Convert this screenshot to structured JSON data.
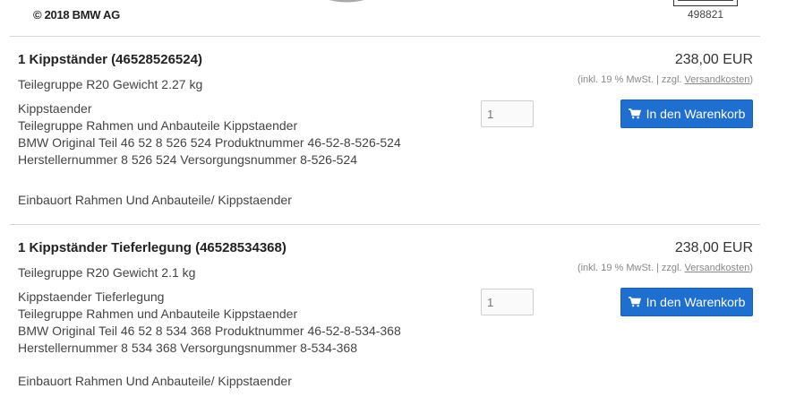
{
  "header": {
    "copyright": "© 2018 BMW AG",
    "diagram_number": "498821"
  },
  "products": [
    {
      "title": "1 Kippständer (46528526524)",
      "subinfo": "Teilegruppe R20 Gewicht 2.27 kg",
      "description": [
        "Kippstaender",
        "Teilegruppe Rahmen und Anbauteile Kippstaender",
        "BMW Original Teil 46 52 8 526 524 Produktnummer 46-52-8-526-524",
        "Herstellernummer 8 526 524 Versorgungsnummer 8-526-524"
      ],
      "location": "Einbauort Rahmen Und Anbauteile/ Kippstaender",
      "price": "238,00 EUR",
      "tax_note": "(inkl. 19 % MwSt. | zzgl. ",
      "shipping_link": "Versandkosten",
      "tax_close": ")",
      "quantity_placeholder": "1",
      "cart_button": "In den Warenkorb"
    },
    {
      "title": "1 Kippständer Tieferlegung (46528534368)",
      "subinfo": "Teilegruppe R20 Gewicht 2.1 kg",
      "description": [
        "Kippstaender Tieferlegung",
        "Teilegruppe Rahmen und Anbauteile Kippstaender",
        "BMW Original Teil 46 52 8 534 368 Produktnummer 46-52-8-534-368",
        "Herstellernummer 8 534 368 Versorgungsnummer 8-534-368"
      ],
      "location": "Einbauort Rahmen Und Anbauteile/ Kippstaender",
      "price": "238,00 EUR",
      "tax_note": "(inkl. 19 % MwSt. | zzgl. ",
      "shipping_link": "Versandkosten",
      "tax_close": ")",
      "quantity_placeholder": "1",
      "cart_button": "In den Warenkorb"
    }
  ],
  "colors": {
    "button_bg": "#1e6fd0",
    "divider": "#d6d6d6"
  },
  "icons": {
    "cart": "shopping-cart-icon"
  }
}
